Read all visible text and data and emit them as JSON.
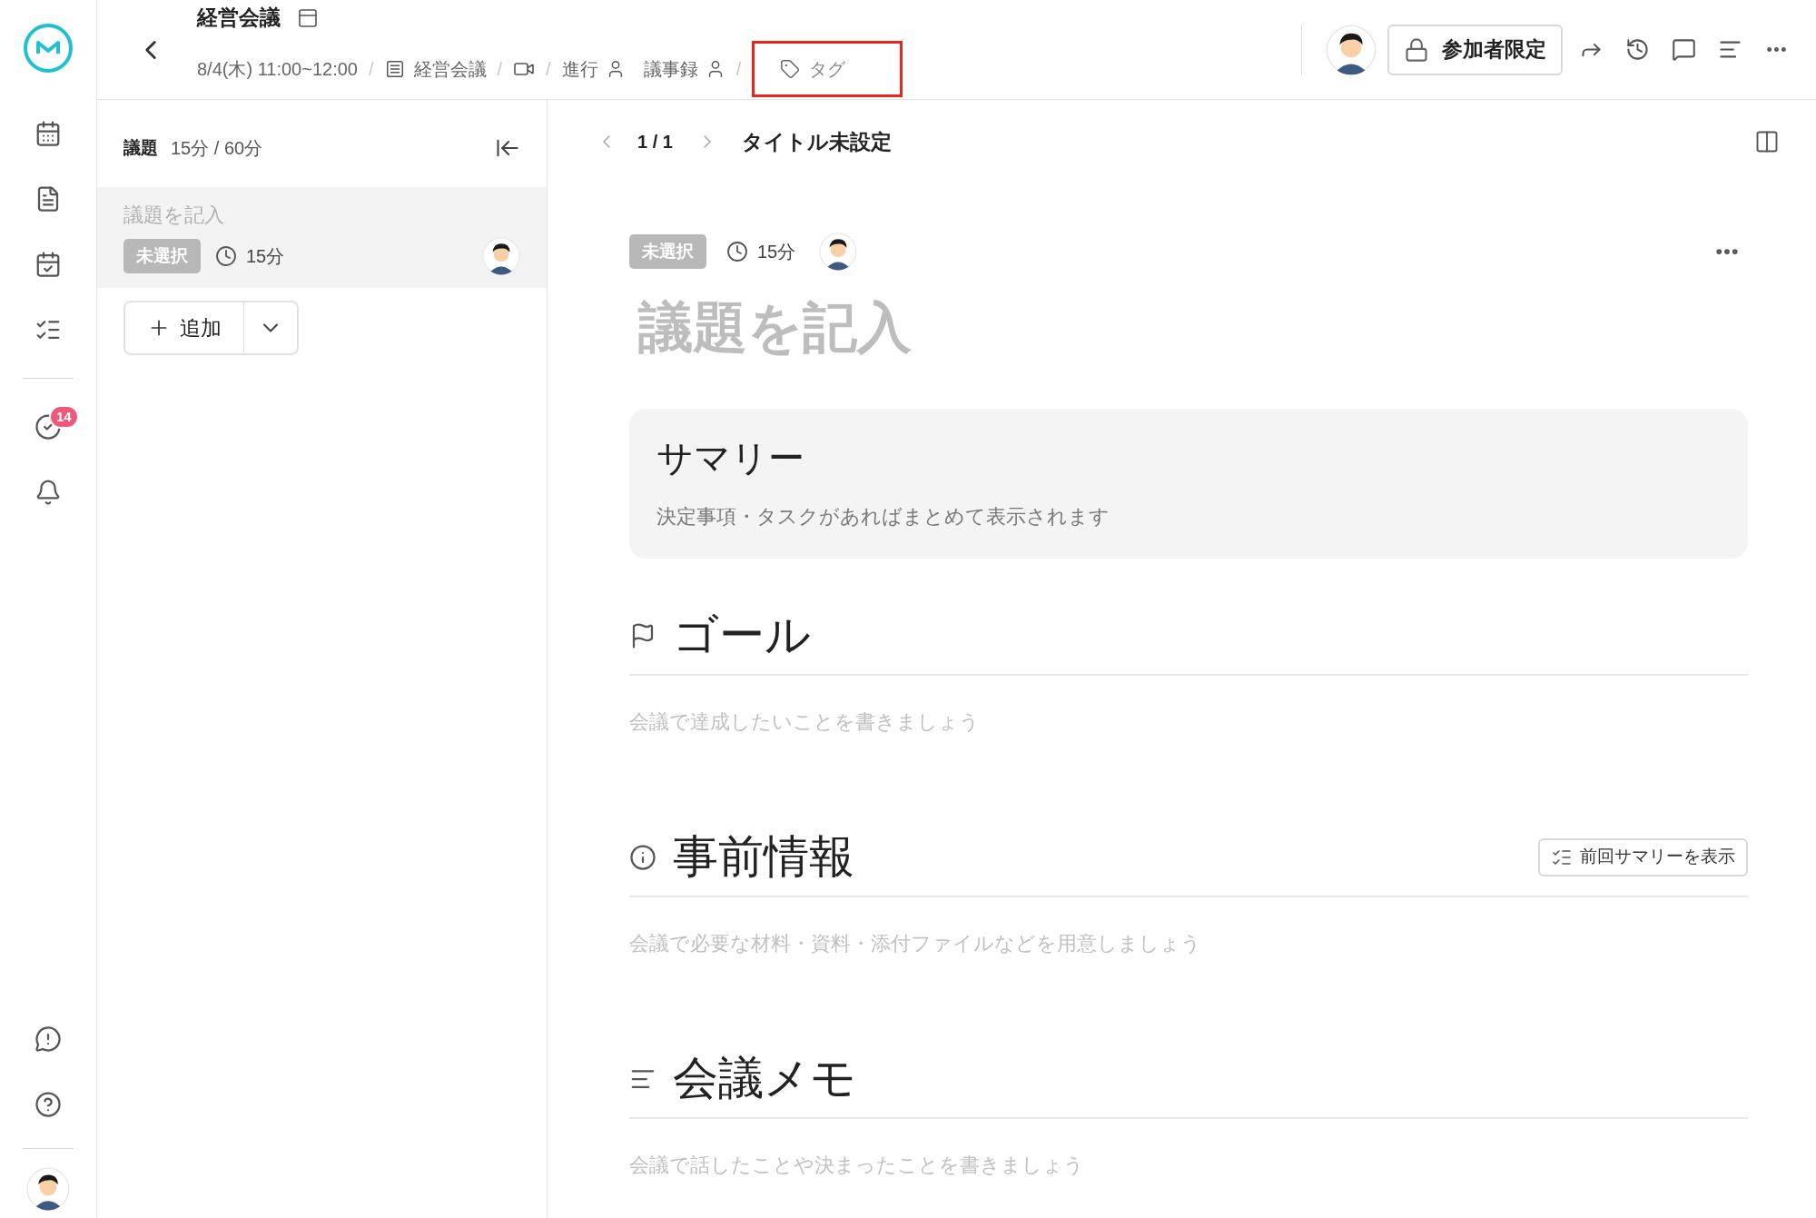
{
  "header": {
    "title": "経営会議",
    "datetime": "8/4(木) 11:00~12:00",
    "folder": "経営会議",
    "facilitator": "進行",
    "minutes": "議事録",
    "tag": {
      "label": "タグ",
      "highlighted": true
    },
    "access_button": "参加者限定",
    "separator": "/"
  },
  "rail": {
    "items": [
      {
        "kind": "calendar"
      },
      {
        "kind": "document"
      },
      {
        "kind": "calendar-check"
      },
      {
        "kind": "list-check"
      },
      {
        "kind": "divider"
      },
      {
        "kind": "task",
        "badge": "14"
      },
      {
        "kind": "bell"
      }
    ],
    "bottom": [
      {
        "kind": "feedback"
      },
      {
        "kind": "help"
      }
    ]
  },
  "agenda_panel": {
    "label": "議題",
    "time": "15分 / 60分",
    "items": [
      {
        "title": "議題を記入",
        "status": "未選択",
        "duration": "15分",
        "selected": true
      }
    ],
    "add_button": "追加"
  },
  "pager": {
    "position": "1 / 1",
    "title": "タイトル未設定"
  },
  "topic": {
    "status": "未選択",
    "duration": "15分",
    "title": "議題を記入"
  },
  "summary": {
    "title": "サマリー",
    "text": "決定事項・タスクがあればまとめて表示されます"
  },
  "sections": [
    {
      "kind": "goal",
      "title": "ゴール",
      "placeholder": "会議で達成したいことを書きましょう"
    },
    {
      "kind": "info",
      "title": "事前情報",
      "placeholder": "会議で必要な材料・資料・添付ファイルなどを用意しましょう",
      "action": "前回サマリーを表示"
    },
    {
      "kind": "memo",
      "title": "会議メモ",
      "placeholder": "会議で話したことや決まったことを書きましょう"
    }
  ]
}
